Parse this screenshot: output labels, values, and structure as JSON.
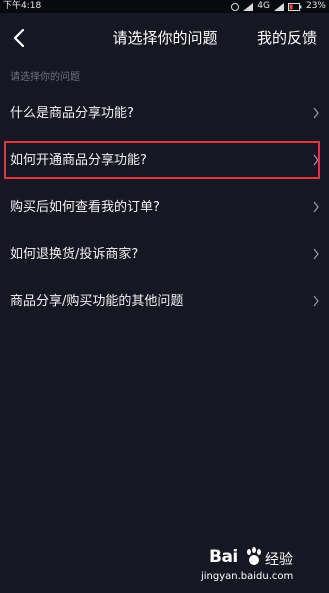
{
  "status_bar": {
    "time": "下午4:18",
    "network": "4G",
    "battery": "23%"
  },
  "header": {
    "back_icon": "chevron-left-icon",
    "title": "请选择你的问题",
    "feedback": "我的反馈"
  },
  "section_label": "请选择你的问题",
  "faq": {
    "items": [
      {
        "label": "什么是商品分享功能?"
      },
      {
        "label": "如何开通商品分享功能?"
      },
      {
        "label": "购买后如何查看我的订单?"
      },
      {
        "label": "如何退换货/投诉商家?"
      },
      {
        "label": "商品分享/购买功能的其他问题"
      }
    ],
    "highlighted_index": 1
  },
  "watermark": {
    "logo": "Bai",
    "brand": "经验",
    "url": "jingyan.baidu.com"
  },
  "colors": {
    "background": "#161723",
    "status_bar": "#090a10",
    "highlight": "#e1353c",
    "muted_text": "#6f7080",
    "text": "#f2f2f2"
  }
}
